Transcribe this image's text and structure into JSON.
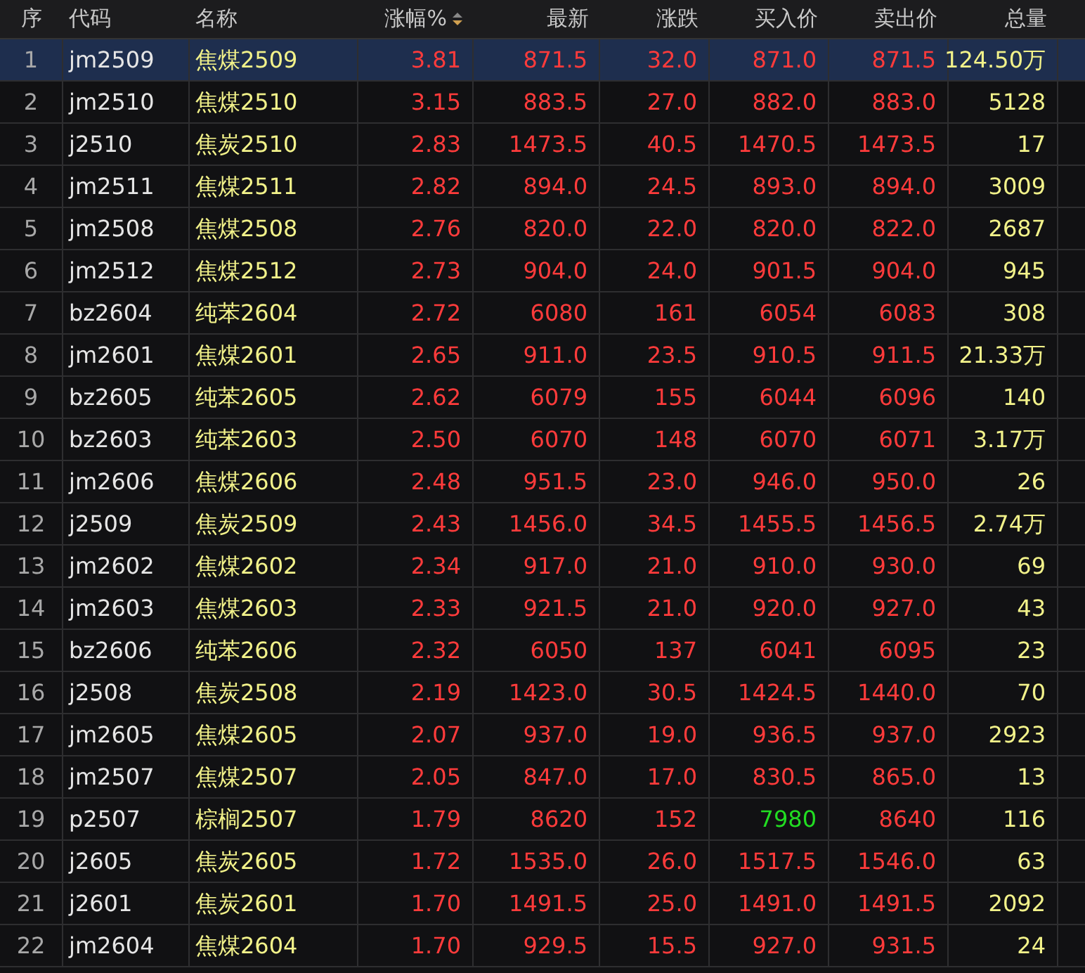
{
  "table": {
    "columns": [
      {
        "label": "序",
        "sorted": false
      },
      {
        "label": "代码",
        "sorted": false
      },
      {
        "label": "名称",
        "sorted": false
      },
      {
        "label": "涨幅%",
        "sorted": true
      },
      {
        "label": "最新",
        "sorted": false
      },
      {
        "label": "涨跌",
        "sorted": false
      },
      {
        "label": "买入价",
        "sorted": false
      },
      {
        "label": "卖出价",
        "sorted": false
      },
      {
        "label": "总量",
        "sorted": false
      }
    ],
    "rows": [
      {
        "cells": [
          "1",
          "jm2509",
          "焦煤2509",
          "3.81",
          "871.5",
          "32.0",
          {
            "text": "871.0",
            "color": "#ff3b3b"
          },
          "871.5",
          "124.50万"
        ],
        "selected": true
      },
      {
        "cells": [
          "2",
          "jm2510",
          "焦煤2510",
          "3.15",
          "883.5",
          "27.0",
          {
            "text": "882.0",
            "color": "#ff3b3b"
          },
          "883.0",
          "5128"
        ],
        "selected": false
      },
      {
        "cells": [
          "3",
          "j2510",
          "焦炭2510",
          "2.83",
          "1473.5",
          "40.5",
          {
            "text": "1470.5",
            "color": "#ff3b3b"
          },
          "1473.5",
          "17"
        ],
        "selected": false
      },
      {
        "cells": [
          "4",
          "jm2511",
          "焦煤2511",
          "2.82",
          "894.0",
          "24.5",
          {
            "text": "893.0",
            "color": "#ff3b3b"
          },
          "894.0",
          "3009"
        ],
        "selected": false
      },
      {
        "cells": [
          "5",
          "jm2508",
          "焦煤2508",
          "2.76",
          "820.0",
          "22.0",
          {
            "text": "820.0",
            "color": "#ff3b3b"
          },
          "822.0",
          "2687"
        ],
        "selected": false
      },
      {
        "cells": [
          "6",
          "jm2512",
          "焦煤2512",
          "2.73",
          "904.0",
          "24.0",
          {
            "text": "901.5",
            "color": "#ff3b3b"
          },
          "904.0",
          "945"
        ],
        "selected": false
      },
      {
        "cells": [
          "7",
          "bz2604",
          "纯苯2604",
          "2.72",
          "6080",
          "161",
          {
            "text": "6054",
            "color": "#ff3b3b"
          },
          "6083",
          "308"
        ],
        "selected": false
      },
      {
        "cells": [
          "8",
          "jm2601",
          "焦煤2601",
          "2.65",
          "911.0",
          "23.5",
          {
            "text": "910.5",
            "color": "#ff3b3b"
          },
          "911.5",
          "21.33万"
        ],
        "selected": false
      },
      {
        "cells": [
          "9",
          "bz2605",
          "纯苯2605",
          "2.62",
          "6079",
          "155",
          {
            "text": "6044",
            "color": "#ff3b3b"
          },
          "6096",
          "140"
        ],
        "selected": false
      },
      {
        "cells": [
          "10",
          "bz2603",
          "纯苯2603",
          "2.50",
          "6070",
          "148",
          {
            "text": "6070",
            "color": "#ff3b3b"
          },
          "6071",
          "3.17万"
        ],
        "selected": false
      },
      {
        "cells": [
          "11",
          "jm2606",
          "焦煤2606",
          "2.48",
          "951.5",
          "23.0",
          {
            "text": "946.0",
            "color": "#ff3b3b"
          },
          "950.0",
          "26"
        ],
        "selected": false
      },
      {
        "cells": [
          "12",
          "j2509",
          "焦炭2509",
          "2.43",
          "1456.0",
          "34.5",
          {
            "text": "1455.5",
            "color": "#ff3b3b"
          },
          "1456.5",
          "2.74万"
        ],
        "selected": false
      },
      {
        "cells": [
          "13",
          "jm2602",
          "焦煤2602",
          "2.34",
          "917.0",
          "21.0",
          {
            "text": "910.0",
            "color": "#ff3b3b"
          },
          "930.0",
          "69"
        ],
        "selected": false
      },
      {
        "cells": [
          "14",
          "jm2603",
          "焦煤2603",
          "2.33",
          "921.5",
          "21.0",
          {
            "text": "920.0",
            "color": "#ff3b3b"
          },
          "927.0",
          "43"
        ],
        "selected": false
      },
      {
        "cells": [
          "15",
          "bz2606",
          "纯苯2606",
          "2.32",
          "6050",
          "137",
          {
            "text": "6041",
            "color": "#ff3b3b"
          },
          "6095",
          "23"
        ],
        "selected": false
      },
      {
        "cells": [
          "16",
          "j2508",
          "焦炭2508",
          "2.19",
          "1423.0",
          "30.5",
          {
            "text": "1424.5",
            "color": "#ff3b3b"
          },
          "1440.0",
          "70"
        ],
        "selected": false
      },
      {
        "cells": [
          "17",
          "jm2605",
          "焦煤2605",
          "2.07",
          "937.0",
          "19.0",
          {
            "text": "936.5",
            "color": "#ff3b3b"
          },
          "937.0",
          "2923"
        ],
        "selected": false
      },
      {
        "cells": [
          "18",
          "jm2507",
          "焦煤2507",
          "2.05",
          "847.0",
          "17.0",
          {
            "text": "830.5",
            "color": "#ff3b3b"
          },
          "865.0",
          "13"
        ],
        "selected": false
      },
      {
        "cells": [
          "19",
          "p2507",
          "棕榈2507",
          "1.79",
          "8620",
          "152",
          {
            "text": "7980",
            "color": "#22dd22"
          },
          "8640",
          "116"
        ],
        "selected": false
      },
      {
        "cells": [
          "20",
          "j2605",
          "焦炭2605",
          "1.72",
          "1535.0",
          "26.0",
          {
            "text": "1517.5",
            "color": "#ff3b3b"
          },
          "1546.0",
          "63"
        ],
        "selected": false
      },
      {
        "cells": [
          "21",
          "j2601",
          "焦炭2601",
          "1.70",
          "1491.5",
          "25.0",
          {
            "text": "1491.0",
            "color": "#ff3b3b"
          },
          "1491.5",
          "2092"
        ],
        "selected": false
      },
      {
        "cells": [
          "22",
          "jm2604",
          "焦煤2604",
          "1.70",
          "929.5",
          "15.5",
          {
            "text": "927.0",
            "color": "#ff3b3b"
          },
          "931.5",
          "24"
        ],
        "selected": false
      }
    ]
  }
}
